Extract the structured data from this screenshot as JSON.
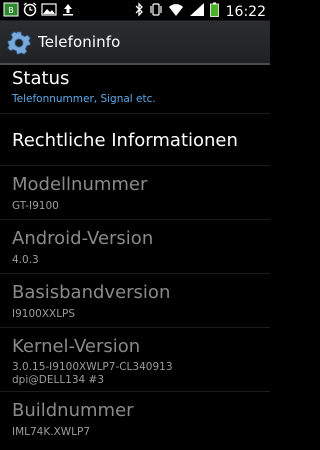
{
  "status_bar": {
    "time": "16:22",
    "left_icons": [
      "battery-charging-icon",
      "alarm-icon",
      "image-icon",
      "upload-icon"
    ],
    "right_icons": [
      "bluetooth-icon",
      "vibrate-icon",
      "wifi-icon",
      "signal-icon",
      "battery-icon"
    ]
  },
  "action_bar": {
    "title": "Telefoninfo",
    "icon": "settings-gear-icon"
  },
  "items": [
    {
      "title": "Status",
      "subtitle": "Telefonnummer, Signal etc."
    },
    {
      "title": "Rechtliche Informationen",
      "subtitle": ""
    },
    {
      "title": "Modellnummer",
      "subtitle": "GT-I9100"
    },
    {
      "title": "Android-Version",
      "subtitle": "4.0.3"
    },
    {
      "title": "Basisbandversion",
      "subtitle": "I9100XXLPS"
    },
    {
      "title": "Kernel-Version",
      "subtitle_line1": "3.0.15-I9100XWLP7-CL340913",
      "subtitle_line2": "dpi@DELL134 #3"
    },
    {
      "title": "Buildnummer",
      "subtitle": "IML74K.XWLP7"
    }
  ],
  "colors": {
    "accent_subtitle": "#5da9e6",
    "disabled_title": "#8a8a8a"
  }
}
